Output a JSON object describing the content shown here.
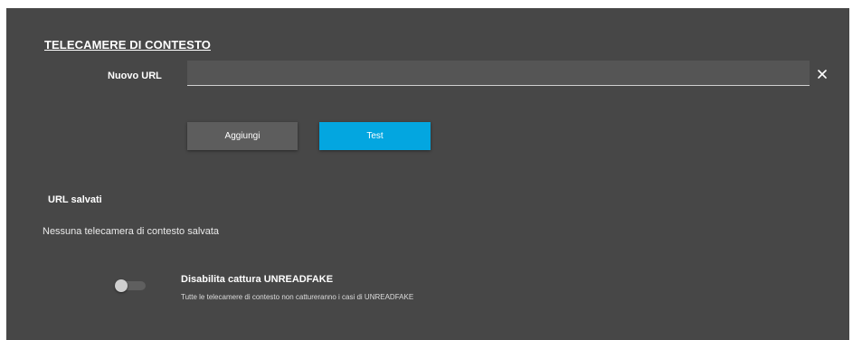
{
  "section": {
    "title": "TELECAMERE DI CONTESTO"
  },
  "new_url": {
    "label": "Nuovo URL",
    "value": "",
    "placeholder": "",
    "clear_icon": "close-icon"
  },
  "buttons": {
    "add_label": "Aggiungi",
    "test_label": "Test"
  },
  "saved": {
    "title": "URL salvati",
    "empty_message": "Nessuna telecamera di contesto salvata"
  },
  "unreadfake": {
    "toggle_on": false,
    "title": "Disabilita cattura UNREADFAKE",
    "description": "Tutte le telecamere di contesto non cattureranno i casi di UNREADFAKE"
  },
  "colors": {
    "panel_bg": "#474747",
    "accent": "#03a6e0",
    "secondary_button": "#5d5d5d"
  }
}
